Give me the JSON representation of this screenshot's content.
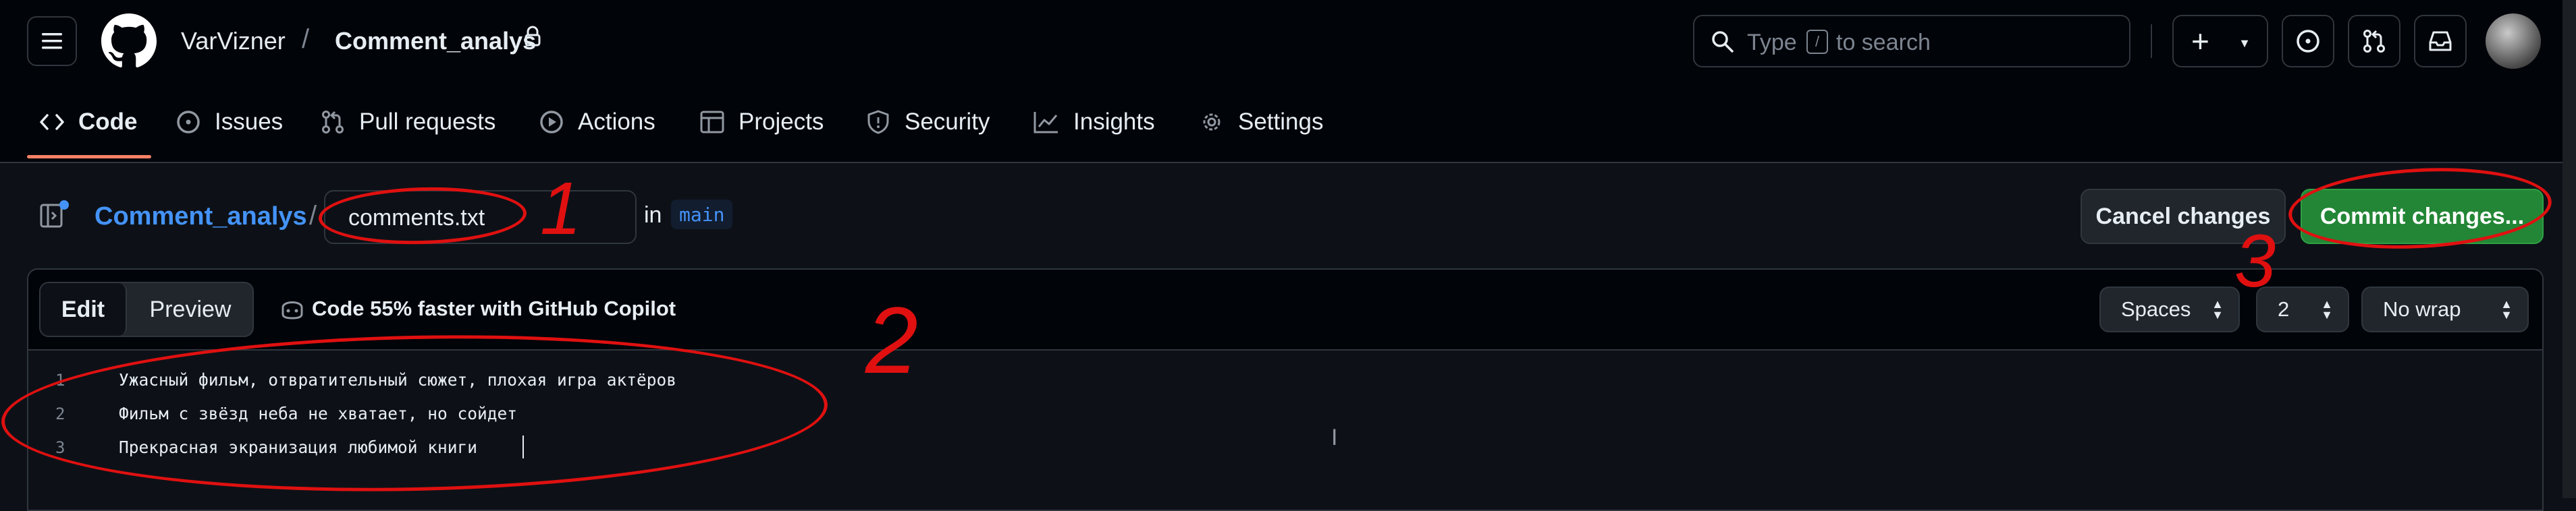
{
  "header": {
    "owner": "VarVizner",
    "separator": "/",
    "repo": "Comment_analys",
    "search_placeholder_pre": "Type",
    "search_key": "/",
    "search_placeholder_post": "to search",
    "new_label": "+"
  },
  "tabs": [
    {
      "label": "Code",
      "icon": "code-icon"
    },
    {
      "label": "Issues",
      "icon": "issue-opened-icon"
    },
    {
      "label": "Pull requests",
      "icon": "git-pull-request-icon"
    },
    {
      "label": "Actions",
      "icon": "play-icon"
    },
    {
      "label": "Projects",
      "icon": "table-icon"
    },
    {
      "label": "Security",
      "icon": "shield-icon"
    },
    {
      "label": "Insights",
      "icon": "graph-icon"
    },
    {
      "label": "Settings",
      "icon": "gear-icon"
    }
  ],
  "editor_header": {
    "repo_link": "Comment_analys",
    "separator": "/",
    "filename": "comments.txt",
    "in_label": "in",
    "branch": "main",
    "cancel_label": "Cancel changes",
    "commit_label": "Commit changes..."
  },
  "toolbar": {
    "edit_label": "Edit",
    "preview_label": "Preview",
    "copilot_text": "Code 55% faster with GitHub Copilot",
    "indent_mode": "Spaces",
    "indent_size": "2",
    "wrap_mode": "No wrap"
  },
  "code_lines": [
    {
      "number": "1",
      "text": "Ужасный фильм, отвратительный сюжет, плохая игра актёров"
    },
    {
      "number": "2",
      "text": "Фильм с звёзд неба не хватает, но сойдет"
    },
    {
      "number": "3",
      "text": "Прекрасная экранизация любимой книги"
    }
  ],
  "annotations": {
    "mark1": "1",
    "mark2": "2",
    "mark3": "3",
    "color": "#e01010"
  },
  "colors": {
    "background": "#0d1117",
    "header": "#010409",
    "link": "#4493f8",
    "commit_button": "#238636",
    "tab_underline": "#f78166"
  }
}
